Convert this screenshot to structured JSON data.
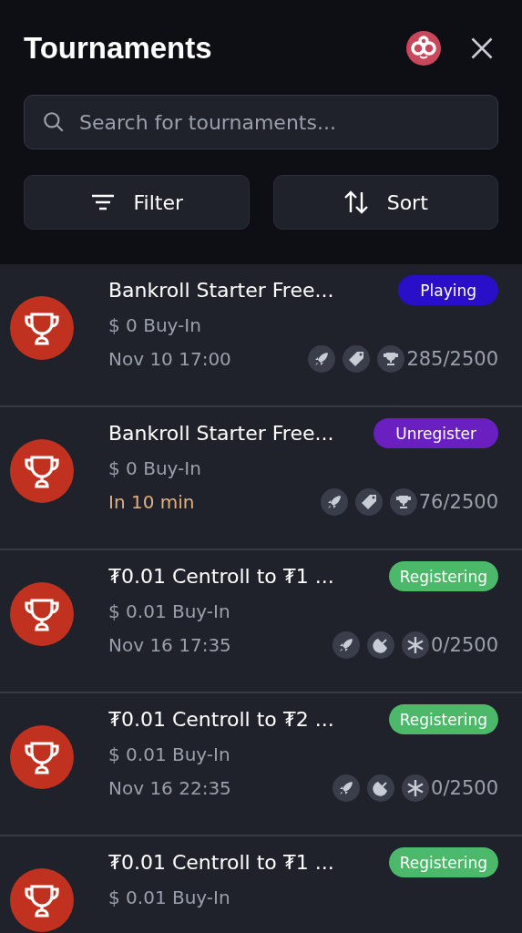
{
  "header": {
    "title": "Tournaments",
    "search": {
      "placeholder": "Search for tournaments..."
    },
    "buttons": [
      {
        "kind": "filter",
        "label": "Filter"
      },
      {
        "kind": "sort",
        "label": "Sort"
      }
    ]
  },
  "tournaments": [
    {
      "name": "Bankroll Starter Free...",
      "status": {
        "kind": "playing",
        "label": "Playing"
      },
      "buy_in": "$ 0 Buy-In",
      "start": {
        "kind": "date",
        "text": "Nov 10 17:00"
      },
      "features": [
        {
          "kind": "rocket"
        },
        {
          "kind": "tag"
        },
        {
          "kind": "trophy"
        }
      ],
      "players": "285/2500"
    },
    {
      "name": "Bankroll Starter Free...",
      "status": {
        "kind": "unregister",
        "label": "Unregister"
      },
      "buy_in": "$ 0 Buy-In",
      "start": {
        "kind": "soon",
        "text": "In 10 min"
      },
      "features": [
        {
          "kind": "rocket"
        },
        {
          "kind": "tag"
        },
        {
          "kind": "trophy"
        }
      ],
      "players": "76/2500"
    },
    {
      "name": "₮0.01 Centroll to ₮1 ...",
      "status": {
        "kind": "registering",
        "label": "Registering"
      },
      "buy_in": "$ 0.01 Buy-In",
      "start": {
        "kind": "date",
        "text": "Nov 16 17:35"
      },
      "features": [
        {
          "kind": "rocket"
        },
        {
          "kind": "satellite"
        },
        {
          "kind": "snowflake"
        }
      ],
      "players": "0/2500"
    },
    {
      "name": "₮0.01 Centroll to ₮2 ...",
      "status": {
        "kind": "registering",
        "label": "Registering"
      },
      "buy_in": "$ 0.01 Buy-In",
      "start": {
        "kind": "date",
        "text": "Nov 16 22:35"
      },
      "features": [
        {
          "kind": "rocket"
        },
        {
          "kind": "satellite"
        },
        {
          "kind": "snowflake"
        }
      ],
      "players": "0/2500"
    },
    {
      "name": "₮0.01 Centroll to ₮1 ...",
      "status": {
        "kind": "registering",
        "label": "Registering"
      },
      "buy_in": "$ 0.01 Buy-In"
    }
  ]
}
